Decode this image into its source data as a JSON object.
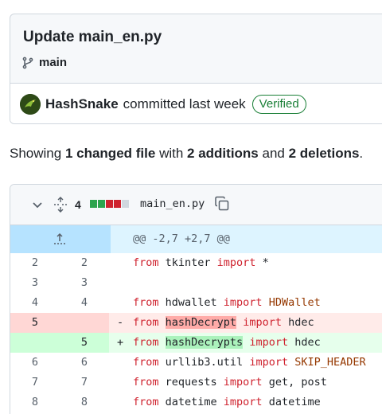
{
  "commit": {
    "title": "Update main_en.py",
    "branch": "main",
    "author": "HashSnake",
    "committed_text": "committed last week",
    "verified_label": "Verified"
  },
  "summary": {
    "prefix": "Showing",
    "files_changed": "1 changed file",
    "with": "with",
    "additions": "2 additions",
    "and": "and",
    "deletions": "2 deletions",
    "suffix": "."
  },
  "file": {
    "change_count": "4",
    "diffstat": [
      "add",
      "add",
      "del",
      "del",
      "neutral"
    ],
    "name": "main_en.py"
  },
  "hunk_header": "@@ -2,7 +2,7 @@",
  "diff_lines": [
    {
      "type": "ctx",
      "left": "2",
      "right": "2",
      "sign": "",
      "tokens": [
        [
          "kw",
          "from"
        ],
        [
          "t",
          " tkinter "
        ],
        [
          "kw",
          "import"
        ],
        [
          "t",
          " *"
        ]
      ]
    },
    {
      "type": "ctx",
      "left": "3",
      "right": "3",
      "sign": "",
      "tokens": []
    },
    {
      "type": "ctx",
      "left": "4",
      "right": "4",
      "sign": "",
      "tokens": [
        [
          "kw",
          "from"
        ],
        [
          "t",
          " hdwallet "
        ],
        [
          "kw",
          "import"
        ],
        [
          "t",
          " "
        ],
        [
          "cls",
          "HDWallet"
        ]
      ]
    },
    {
      "type": "del",
      "left": "5",
      "right": "",
      "sign": "-",
      "tokens": [
        [
          "kw",
          "from"
        ],
        [
          "t",
          " "
        ],
        [
          "hl-del",
          "hashDecrypt"
        ],
        [
          "t",
          " "
        ],
        [
          "kw",
          "import"
        ],
        [
          "t",
          " hdec"
        ]
      ]
    },
    {
      "type": "add",
      "left": "",
      "right": "5",
      "sign": "+",
      "tokens": [
        [
          "kw",
          "from"
        ],
        [
          "t",
          " "
        ],
        [
          "hl-add",
          "hashDecrypts"
        ],
        [
          "t",
          " "
        ],
        [
          "kw",
          "import"
        ],
        [
          "t",
          " hdec"
        ]
      ]
    },
    {
      "type": "ctx",
      "left": "6",
      "right": "6",
      "sign": "",
      "tokens": [
        [
          "kw",
          "from"
        ],
        [
          "t",
          " urllib3.util "
        ],
        [
          "kw",
          "import"
        ],
        [
          "t",
          " "
        ],
        [
          "cls",
          "SKIP_HEADER"
        ]
      ]
    },
    {
      "type": "ctx",
      "left": "7",
      "right": "7",
      "sign": "",
      "tokens": [
        [
          "kw",
          "from"
        ],
        [
          "t",
          " requests "
        ],
        [
          "kw",
          "import"
        ],
        [
          "t",
          " get, post"
        ]
      ]
    },
    {
      "type": "ctx",
      "left": "8",
      "right": "8",
      "sign": "",
      "tokens": [
        [
          "kw",
          "from"
        ],
        [
          "t",
          " datetime "
        ],
        [
          "kw",
          "import"
        ],
        [
          "t",
          " datetime"
        ]
      ]
    }
  ],
  "colors": {
    "addition": "#2da44e",
    "deletion": "#cf222e",
    "neutral": "#d0d7de",
    "verified": "#1a7f37"
  }
}
